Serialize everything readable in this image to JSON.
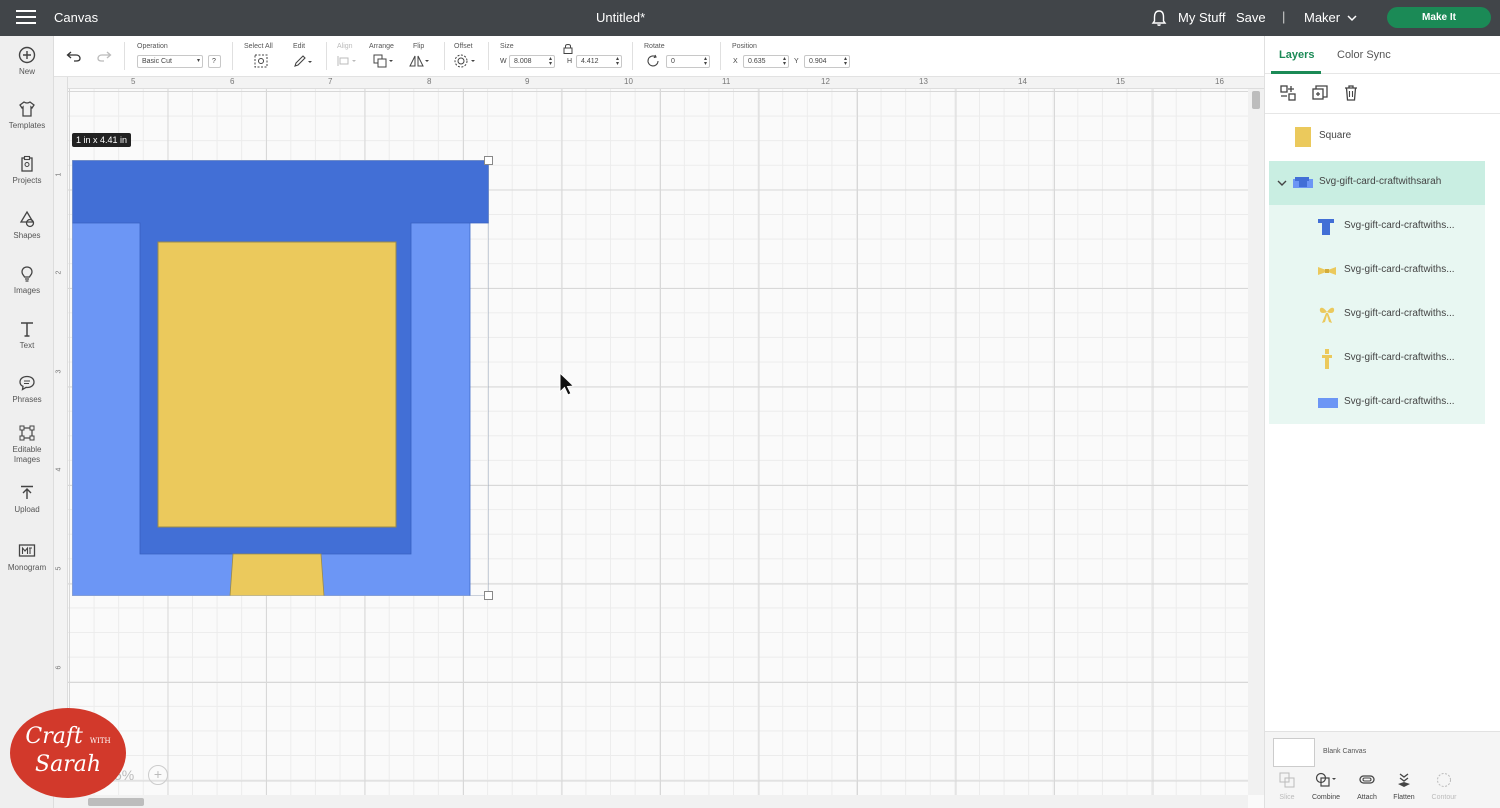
{
  "topbar": {
    "app_title": "Canvas",
    "document_title": "Untitled*",
    "my_stuff": "My Stuff",
    "save": "Save",
    "separator": "|",
    "machine": "Maker",
    "make_it": "Make It"
  },
  "left_toolbar": [
    {
      "name": "new",
      "label": "New",
      "icon": "plus-circle-icon"
    },
    {
      "name": "templates",
      "label": "Templates",
      "icon": "shirt-icon"
    },
    {
      "name": "projects",
      "label": "Projects",
      "icon": "clipboard-icon"
    },
    {
      "name": "shapes",
      "label": "Shapes",
      "icon": "shapes-icon"
    },
    {
      "name": "images",
      "label": "Images",
      "icon": "lightbulb-icon"
    },
    {
      "name": "text",
      "label": "Text",
      "icon": "text-t-icon"
    },
    {
      "name": "phrases",
      "label": "Phrases",
      "icon": "speech-bubble-icon"
    },
    {
      "name": "editable-images",
      "label": "Editable Images",
      "icon": "editable-image-icon"
    },
    {
      "name": "upload",
      "label": "Upload",
      "icon": "upload-icon"
    },
    {
      "name": "monogram",
      "label": "Monogram",
      "icon": "monogram-icon"
    }
  ],
  "edit_toolbar": {
    "operation_label": "Operation",
    "operation_value": "Basic Cut",
    "operation_help": "?",
    "select_all_label": "Select All",
    "edit_label": "Edit",
    "align_label": "Align",
    "arrange_label": "Arrange",
    "flip_label": "Flip",
    "offset_label": "Offset",
    "size_label": "Size",
    "w_label": "W",
    "w_value": "8.008",
    "h_label": "H",
    "h_value": "4.412",
    "rotate_label": "Rotate",
    "rotate_value": "0",
    "position_label": "Position",
    "x_label": "X",
    "x_value": "0.635",
    "y_label": "Y",
    "y_value": "0.904"
  },
  "rulers": {
    "top": [
      "5",
      "6",
      "7",
      "8",
      "9",
      "10",
      "11",
      "12",
      "13",
      "14",
      "15",
      "16"
    ],
    "top_first": "0",
    "left": [
      "1",
      "2",
      "3",
      "4",
      "5",
      "6"
    ]
  },
  "canvas": {
    "dimension_tooltip": "1  in x 4.41  in",
    "zoom_text": "5%",
    "zoom_plus": "+"
  },
  "design_colors": {
    "dark_blue": "#426fd6",
    "light_blue": "#6c96f5",
    "yellow": "#ebc95c"
  },
  "right_panel": {
    "tab_layers": "Layers",
    "tab_color_sync": "Color Sync",
    "layers": [
      {
        "name": "Square",
        "color": "#ebc95c",
        "icon": "square-swatch-icon"
      }
    ],
    "group": {
      "name": "Svg-gift-card-craftwithsarah",
      "expanded": true,
      "children": [
        {
          "name": "Svg-gift-card-craftwiths...",
          "icon": "t-shape-icon",
          "color": "#426fd6"
        },
        {
          "name": "Svg-gift-card-craftwiths...",
          "icon": "bow-flat-icon",
          "color": "#ebc95c"
        },
        {
          "name": "Svg-gift-card-craftwiths...",
          "icon": "bow-icon",
          "color": "#ebc95c"
        },
        {
          "name": "Svg-gift-card-craftwiths...",
          "icon": "tag-piece-icon",
          "color": "#ebc95c"
        },
        {
          "name": "Svg-gift-card-craftwiths...",
          "icon": "rectangle-icon",
          "color": "#6c96f5"
        }
      ]
    },
    "blank_canvas": "Blank Canvas",
    "bottom_tools": [
      {
        "name": "slice",
        "label": "Slice",
        "enabled": false
      },
      {
        "name": "combine",
        "label": "Combine",
        "enabled": true
      },
      {
        "name": "attach",
        "label": "Attach",
        "enabled": true
      },
      {
        "name": "flatten",
        "label": "Flatten",
        "enabled": true
      },
      {
        "name": "contour",
        "label": "Contour",
        "enabled": false
      }
    ]
  },
  "watermark": {
    "line1": "Craft",
    "line1_small": "WITH",
    "line2": "Sarah"
  }
}
